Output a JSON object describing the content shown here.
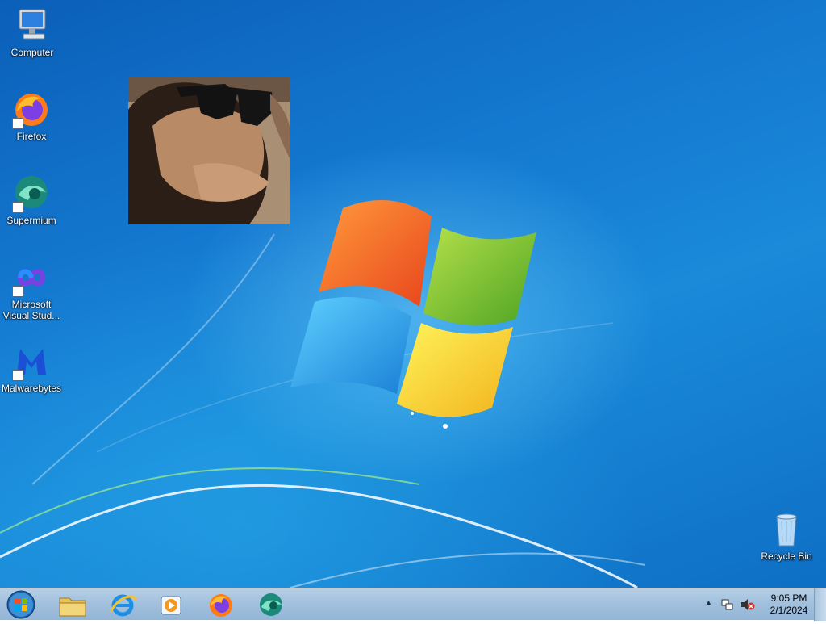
{
  "desktop": {
    "icons": [
      {
        "label": "Computer"
      },
      {
        "label": "Firefox"
      },
      {
        "label": "Supermium"
      },
      {
        "label": "Microsoft Visual Stud..."
      },
      {
        "label": "Malwarebytes"
      },
      {
        "label": "Recycle Bin"
      }
    ]
  },
  "taskbar": {
    "pinned": [
      "windows-explorer",
      "internet-explorer",
      "windows-media-player",
      "firefox",
      "supermium"
    ],
    "clock": {
      "time": "9:05 PM",
      "date": "2/1/2024"
    }
  },
  "colors": {
    "desktop_blue": "#1479d0",
    "taskbar": "#a3c1de"
  }
}
